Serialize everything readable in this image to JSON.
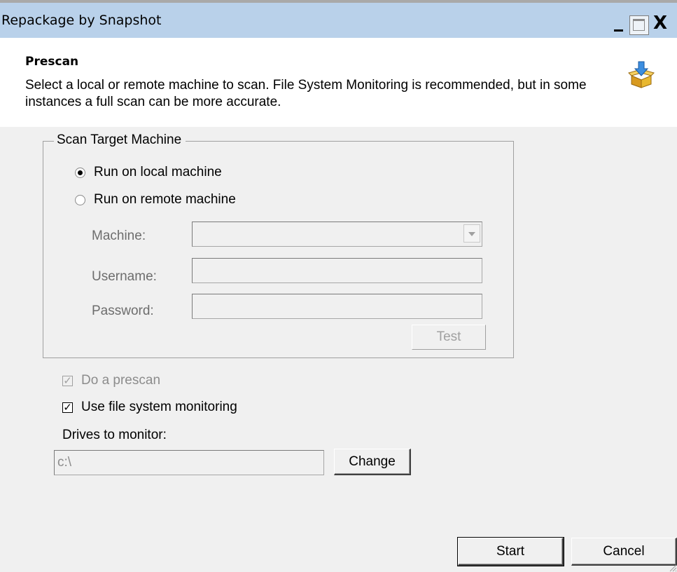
{
  "window": {
    "title": "Repackage by Snapshot",
    "controls": {
      "minimize_icon": "minimize-icon",
      "maximize_icon": "maximize-icon",
      "close_label": "X"
    }
  },
  "header": {
    "title": "Prescan",
    "description": "Select a local or remote machine to scan. File System Monitoring is recommended, but in some instances a full scan can be more accurate.",
    "icon": "package-download-icon"
  },
  "scan_target": {
    "legend": "Scan Target Machine",
    "options": [
      {
        "label": "Run on local machine",
        "selected": true
      },
      {
        "label": "Run on remote machine",
        "selected": false
      }
    ],
    "machine": {
      "label": "Machine:",
      "value": "",
      "enabled": false
    },
    "username": {
      "label": "Username:",
      "value": "",
      "enabled": false
    },
    "password": {
      "label": "Password:",
      "value": "",
      "enabled": false
    },
    "test_button": {
      "label": "Test",
      "enabled": false
    }
  },
  "options": {
    "prescan": {
      "label": "Do a prescan",
      "checked": true,
      "enabled": false
    },
    "fs_monitoring": {
      "label": "Use file system monitoring",
      "checked": true,
      "enabled": true
    },
    "drives_label": "Drives to monitor:",
    "drives_value": "c:\\",
    "change_button": "Change"
  },
  "footer": {
    "start_button": "Start",
    "cancel_button": "Cancel"
  },
  "colors": {
    "titlebar": "#b9d1ea",
    "window_bg": "#f0f0f0",
    "header_bg": "#ffffff",
    "disabled_text": "#8c8c8c"
  }
}
